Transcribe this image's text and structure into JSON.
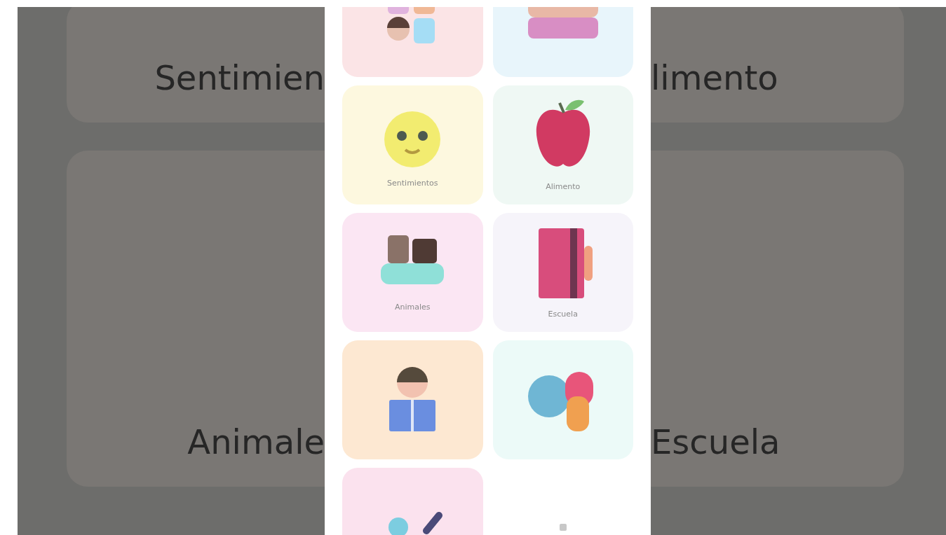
{
  "background": {
    "rows": [
      {
        "left_label": "Sentimien",
        "right_label": "limento"
      },
      {
        "left_label": "Animale",
        "right_label": "Escuela"
      }
    ]
  },
  "tiles": [
    {
      "kind": "people",
      "color": "#fbe4e6"
    },
    {
      "kind": "family",
      "color": "#e8f5fb"
    },
    {
      "kind": "smiley",
      "color": "#fdf8df",
      "label": "Sentimientos"
    },
    {
      "kind": "apple",
      "color": "#eff8f4",
      "label": "Alimento"
    },
    {
      "kind": "dogs",
      "color": "#fbe6f3",
      "label": "Animales"
    },
    {
      "kind": "notebook",
      "color": "#f6f4fa",
      "label": "Escuela"
    },
    {
      "kind": "reader",
      "color": "#fde8d2"
    },
    {
      "kind": "balloons",
      "color": "#ecfaf8"
    },
    {
      "kind": "paint",
      "color": "#fbe2ee"
    },
    {
      "kind": "blank",
      "color": "#ffffff"
    }
  ]
}
